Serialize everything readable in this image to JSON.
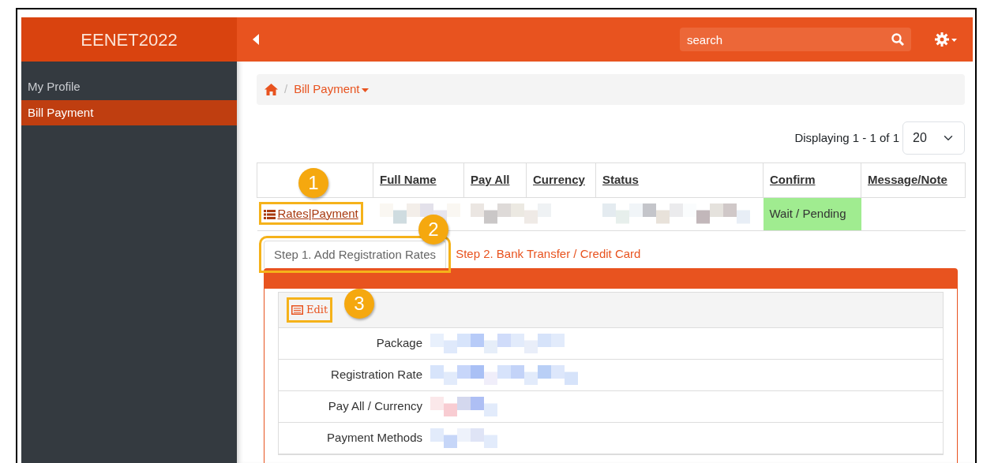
{
  "brand": "EENET2022",
  "search": {
    "placeholder": "search"
  },
  "sidebar": {
    "items": [
      {
        "label": "My Profile",
        "selected": false
      },
      {
        "label": "Bill Payment",
        "selected": true
      }
    ]
  },
  "breadcrumb": {
    "separator": "/",
    "current": "Bill Payment"
  },
  "pagination": {
    "text": "Displaying 1 - 1 of 1",
    "page_size": "20"
  },
  "table": {
    "columns": [
      "Full Name",
      "Pay All",
      "Currency",
      "Status",
      "Confirm",
      "Message/Note"
    ],
    "rows": [
      {
        "link": "Rates|Payment",
        "confirm": "Wait / Pending"
      }
    ]
  },
  "tabs": [
    {
      "label": "Step 1. Add Registration Rates",
      "selected": true
    },
    {
      "label": "Step 2. Bank Transfer / Credit Card",
      "selected": false
    }
  ],
  "edit_button": "Edit",
  "details": [
    "Package",
    "Registration Rate",
    "Pay All / Currency",
    "Payment Methods"
  ],
  "callouts": [
    "1",
    "2",
    "3"
  ]
}
